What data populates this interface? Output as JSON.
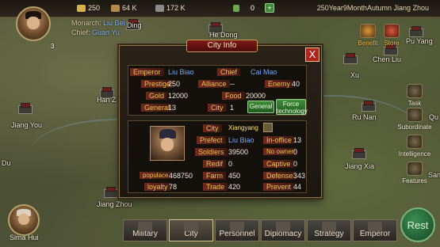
{
  "topbar": {
    "resources": [
      {
        "icon": "gold-coins-icon",
        "value": "250"
      },
      {
        "icon": "grain-sack-icon",
        "value": "64 K"
      },
      {
        "icon": "soldier-icon",
        "value": "172 K"
      }
    ],
    "scroll_count": "0",
    "add_symbol": "+",
    "date_text": "250Year9MonthAutumn Jiang Zhou"
  },
  "ruler": {
    "monarch_label": "Monarch:",
    "monarch_name": "Liu Bei",
    "chief_label": "Chief:",
    "chief_name": "Guan Yu",
    "level_badge": "3"
  },
  "map_labels": {
    "ding": "Ding",
    "he_dong": "He Dong",
    "pu_yang": "Pu Yang",
    "chen_liu": "Chen Liu",
    "xu": "Xu",
    "han_z": "Han Z",
    "jiang_you": "Jiang You",
    "ru_nan": "Ru Nan",
    "du": "Du",
    "jiang_xia": "Jiang Xia",
    "jiang_zhou": "Jiang Zhou",
    "san": "San",
    "qu": "Qu"
  },
  "side_buttons": {
    "benefit": "Benefit",
    "store": "Store",
    "task": "Task",
    "subordinate": "Subordinate",
    "intelligence": "Intelligence",
    "features": "Features"
  },
  "left_portrait_name": "Sima Hui",
  "rest_label": "Rest",
  "tabs": [
    "Military",
    "City",
    "Personnel",
    "Diplomacy",
    "Strategy",
    "Emperor"
  ],
  "active_tab": "City",
  "dialog": {
    "title": "City Info",
    "close": "X",
    "emperor_label": "Emperor",
    "emperor_value": "Liu Biao",
    "chief_label": "Chief",
    "chief_value": "Cai Mao",
    "prestige_label": "Prestige",
    "prestige_value": "250",
    "alliance_label": "Alliance",
    "alliance_value": "--",
    "enemy_label": "Enemy",
    "enemy_value": "40",
    "gold_label": "Gold",
    "gold_value": "12000",
    "food_label": "Food",
    "food_value": "20000",
    "general_label": "General",
    "general_value": "13",
    "city_count_label": "City",
    "city_count_value": "1",
    "general_button": "General",
    "force_button": "Force technology",
    "city_label": "City",
    "city_value": "Xiangyang",
    "prefect_label": "Prefect",
    "prefect_value": "Liu Biao",
    "inoffice_label": "In-office",
    "inoffice_value": "13",
    "soldiers_label": "Soldiers",
    "soldiers_value": "39500",
    "noowner_label": "No owner",
    "noowner_value": "0",
    "redif_label": "Redif",
    "redif_value": "0",
    "captive_label": "Captive",
    "captive_value": "0",
    "populace_label": "populace",
    "populace_value": "468750",
    "farm_label": "Farm",
    "farm_value": "450",
    "defense_label": "Defense",
    "defense_value": "343",
    "loyalty_label": "loyalty",
    "loyalty_value": "78",
    "trade_label": "Trade",
    "trade_value": "420",
    "prevent_label": "Prevent",
    "prevent_value": "44"
  }
}
